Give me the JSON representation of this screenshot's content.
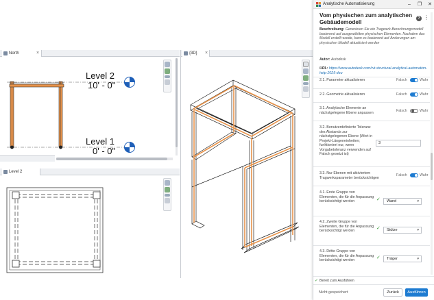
{
  "colors": {
    "accent": "#1d7bd1",
    "highlight_beam": "#e8934a",
    "check": "#3a9a3a"
  },
  "views": {
    "elevation": {
      "tab_label": "North",
      "levels": [
        {
          "name": "Level 2",
          "elevation": "10' - 0\""
        },
        {
          "name": "Level 1",
          "elevation": "0' - 0\""
        }
      ]
    },
    "plan": {
      "tab_label": "Level 2"
    },
    "three_d": {
      "tab_label": "{3D}"
    }
  },
  "panel": {
    "window_title": "Analytische Automatisierung",
    "window_buttons": {
      "minimize": "–",
      "restore": "❐",
      "close": "✕"
    },
    "heading": "Vom physischen zum analytischen Gebäudemodell",
    "description_label": "Beschreibung:",
    "description_text": "Generieren Sie ein Tragwerk-Berechnungsmodell basierend auf ausgewählten physischen Elementen. Nachdem das Modell erstellt wurde, kann es basierend auf Änderungen am physischen Modell aktualisiert werden",
    "author_label": "Autor:",
    "author_value": "Autodesk",
    "url_label": "URL:",
    "url_value": "https://www.autodesk.com/rvt-structural-analytical-automation-help-2025-deu",
    "false_label": "Falsch",
    "true_label": "Wahr",
    "settings": [
      {
        "label": "2.1. Parameter aktualisieren",
        "state": "on"
      },
      {
        "label": "2.2. Geometrie aktualisieren",
        "state": "on"
      },
      {
        "label": "3.1. Analytische Elemente an nächstgelegene Ebene anpassen",
        "state": "off"
      },
      {
        "label": "3.2. Benutzerdefinierte Toleranz des Abstands zur nächstgelegenen Ebene (Wert in Projekt-Längeneinheiten; funktioniert nur, wenn Vorgabetoleranz verwenden auf Falsch gesetzt ist)",
        "value": "3"
      },
      {
        "label": "3.3. Nur Ebenen mit aktiviertem Tragwerksparameter berücksichtigen",
        "state": "on"
      },
      {
        "label": "4.1. Erste Gruppe von Elementen, die für die Anpassung berücksichtigt werden",
        "selected": "Wand"
      },
      {
        "label": "4.2. Zweite Gruppe von Elementen, die für die Anpassung berücksichtigt werden",
        "selected": "Stütze"
      },
      {
        "label": "4.3. Dritte Gruppe von Elementen, die für die Anpassung berücksichtigt werden",
        "selected": "Träger"
      }
    ],
    "footer": {
      "status": "Bereit zum Ausführen",
      "not_saved": "Nicht gespeichert",
      "cancel": "Zurück",
      "run": "Ausführen"
    }
  }
}
